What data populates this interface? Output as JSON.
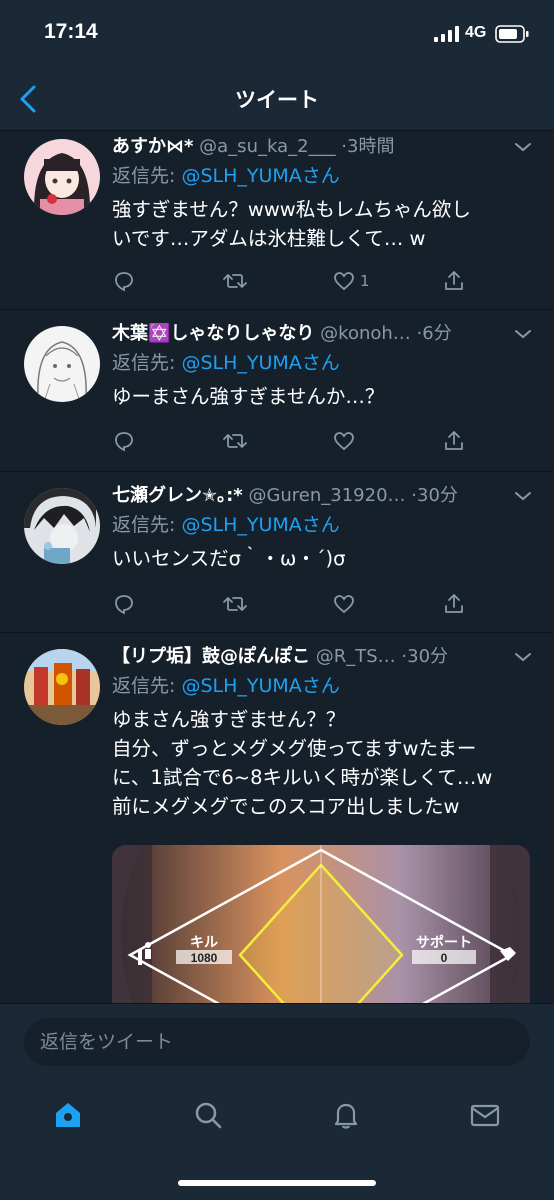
{
  "status_bar": {
    "time": "17:14",
    "network": "4G"
  },
  "nav": {
    "title": "ツイート"
  },
  "tweets": [
    {
      "name": "あすか⋈*",
      "handle": "@a_su_ka_2___",
      "time": "3時間",
      "reply_prefix": "返信先: ",
      "reply_mention": "@SLH_YUMAさん",
      "text": "強すぎません？www私もレムちゃん欲し\nいです…アダムは氷柱難しくて… w",
      "likes": "1"
    },
    {
      "name": "木葉✡️しゃなりしゃなり",
      "handle": "@konoh…",
      "time": "6分",
      "reply_prefix": "返信先: ",
      "reply_mention": "@SLH_YUMAさん",
      "text": "ゆーまさん強すぎませんか…？",
      "likes": ""
    },
    {
      "name": "七瀬グレン✭｡:*",
      "handle": "@Guren_31920…",
      "time": "30分",
      "reply_prefix": "返信先: ",
      "reply_mention": "@SLH_YUMAさん",
      "text": "いいセンスだσ｀・ω・´)σ",
      "likes": ""
    },
    {
      "name": "【リプ垢】鼓@ぽんぽこ",
      "handle": "@R_TS…",
      "time": "30分",
      "reply_prefix": "返信先: ",
      "reply_mention": "@SLH_YUMAさん",
      "text": "ゆまさん強すぎません？？\n自分、ずっとメグメグ使ってますwたまー\nに、1試合で6~8キルいく時が楽しくて…w\n前にメグメグでこのスコア出しましたw",
      "likes": "",
      "media": {
        "kill_label": "キル",
        "kill_value": "1080",
        "support_label": "サポート",
        "support_value": "0"
      }
    }
  ],
  "reply_box": {
    "placeholder": "返信をツイート"
  },
  "tabs": [
    "home-icon",
    "search-icon",
    "notifications-icon",
    "messages-icon"
  ],
  "colors": {
    "background": "#15202b",
    "bar": "#1b2836",
    "accent": "#1da1f2",
    "secondary": "#8899a6"
  }
}
